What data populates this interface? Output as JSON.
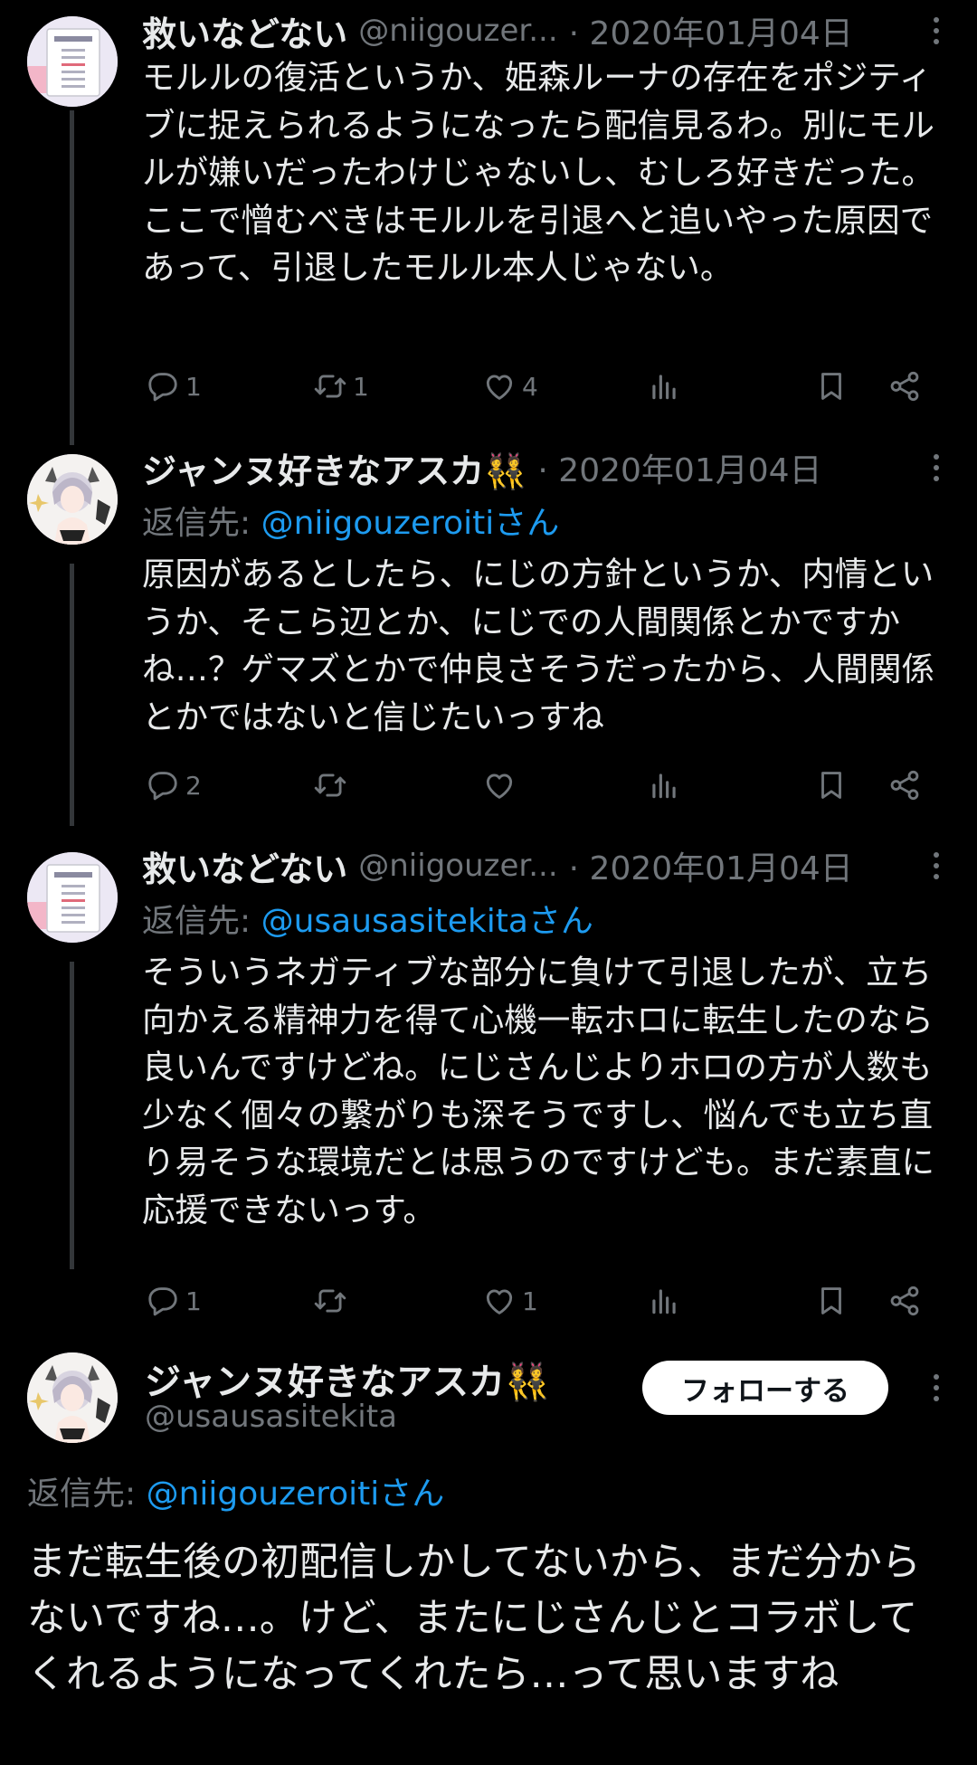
{
  "thread": [
    {
      "name": "救いなどない",
      "handle": "@niigouzer...",
      "date": "· 2020年01月04日",
      "reply_prefix": "",
      "reply_mention": "",
      "text": "モルルの復活というか、姫森ルーナの存在をポジティブに捉えられるようになったら配信見るわ。別にモルルが嫌いだったわけじゃないし、むしろ好きだった。ここで憎むべきはモルルを引退へと追いやった原因であって、引退したモルル本人じゃない。",
      "replies": "1",
      "retweets": "1",
      "likes": "4"
    },
    {
      "name": "ジャンヌ好きなアスカ👯",
      "handle": "",
      "date": "· 2020年01月04日",
      "reply_prefix": "返信先: ",
      "reply_mention": "@niigouzeroitiさん",
      "text": "原因があるとしたら、にじの方針というか、内情というか、そこら辺とか、にじでの人間関係とかですかね…？ゲマズとかで仲良さそうだったから、人間関係とかではないと信じたいっすね",
      "replies": "2",
      "retweets": "",
      "likes": ""
    },
    {
      "name": "救いなどない",
      "handle": "@niigouzer...",
      "date": "· 2020年01月04日",
      "reply_prefix": "返信先: ",
      "reply_mention": "@usausasitekitaさん",
      "text": "そういうネガティブな部分に負けて引退したが、立ち向かえる精神力を得て心機一転ホロに転生したのなら良いんですけどね。にじさんじよりホロの方が人数も少なく個々の繋がりも深そうですし、悩んでも立ち直り易そうな環境だとは思うのですけども。まだ素直に応援できないっす。",
      "replies": "1",
      "retweets": "",
      "likes": "1"
    }
  ],
  "focused": {
    "name": "ジャンヌ好きなアスカ👯",
    "handle": "@usausasitekita",
    "follow_label": "フォローする",
    "reply_prefix": "返信先: ",
    "reply_mention": "@niigouzeroitiさん",
    "text": "まだ転生後の初配信しかしてないから、まだ分からないですね…。けど、またにじさんじとコラボしてくれるようになってくれたら…って思いますね"
  },
  "colors": {
    "background": "#000000",
    "text": "#e7e9ea",
    "muted": "#71767b",
    "link": "#1d9bf0"
  }
}
